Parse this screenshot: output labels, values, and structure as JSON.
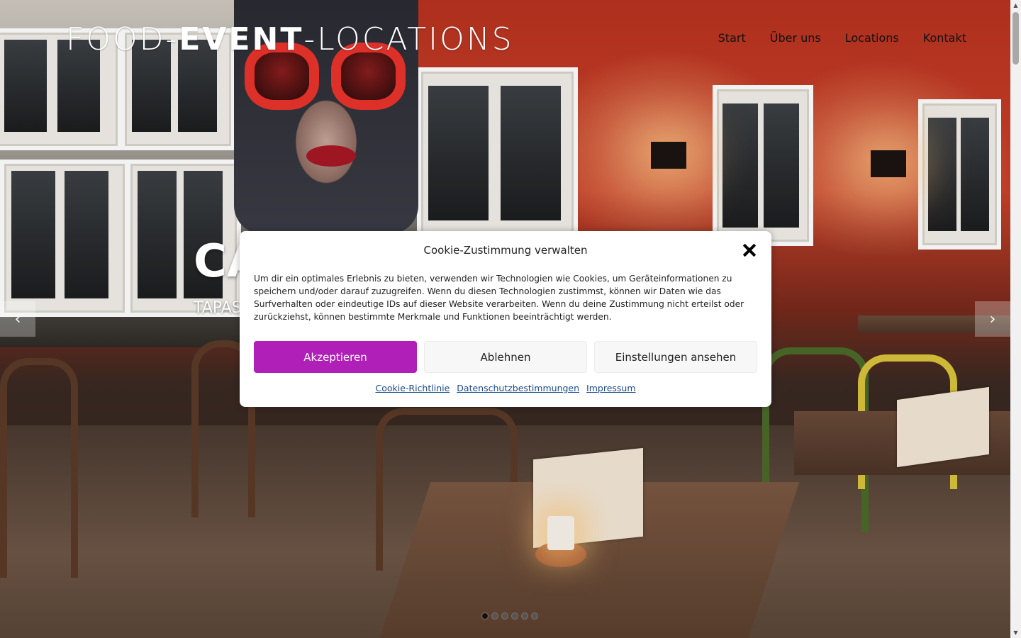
{
  "header": {
    "logo": {
      "prefix": "FOOD-",
      "bold": "EVENT",
      "suffix": "-LOCATIONS"
    },
    "nav": [
      {
        "label": "Start"
      },
      {
        "label": "Über uns"
      },
      {
        "label": "Locations"
      },
      {
        "label": "Kontakt"
      }
    ]
  },
  "slider": {
    "title": "CA",
    "subtitle": "TAPAS",
    "prev_arrow": "‹",
    "next_arrow": "›",
    "slide_count": 6,
    "active_slide": 1
  },
  "cookie_dialog": {
    "title": "Cookie-Zustimmung verwalten",
    "text": "Um dir ein optimales Erlebnis zu bieten, verwenden wir Technologien wie Cookies, um Geräteinformationen zu speichern und/oder darauf zuzugreifen. Wenn du diesen Technologien zustimmst, können wir Daten wie das Surfverhalten oder eindeutige IDs auf dieser Website verarbeiten. Wenn du deine Zustimmung nicht erteilst oder zurückziehst, können bestimmte Merkmale und Funktionen beeinträchtigt werden.",
    "accept_label": "Akzeptieren",
    "deny_label": "Ablehnen",
    "settings_label": "Einstellungen ansehen",
    "links": [
      {
        "label": "Cookie-Richtlinie"
      },
      {
        "label": "Datenschutzbestimmungen"
      },
      {
        "label": "Impressum"
      }
    ],
    "accent_color": "#b01fb8"
  },
  "scrollbar": {
    "up": "▲",
    "down": "▼"
  }
}
